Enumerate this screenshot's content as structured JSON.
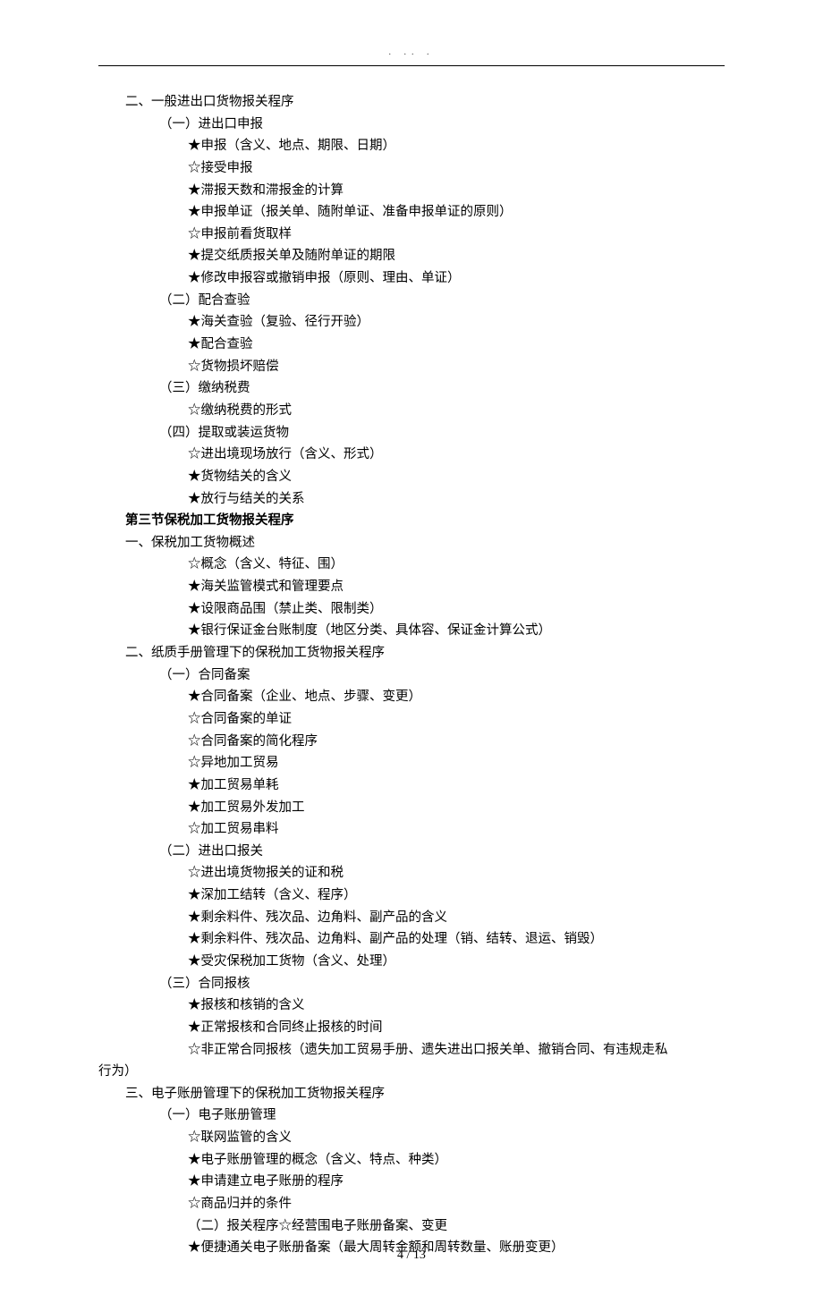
{
  "header_marks": ". .. .",
  "footer": "4 / 13",
  "lines": [
    {
      "cls": "l0",
      "text": "二、一般进出口货物报关程序"
    },
    {
      "cls": "l1",
      "text": "（一）进出口申报"
    },
    {
      "cls": "l2",
      "text": "★申报（含义、地点、期限、日期）"
    },
    {
      "cls": "l2",
      "text": "☆接受申报"
    },
    {
      "cls": "l2",
      "text": "★滞报天数和滞报金的计算"
    },
    {
      "cls": "l2",
      "text": "★申报单证（报关单、随附单证、准备申报单证的原则）"
    },
    {
      "cls": "l2",
      "text": "☆申报前看货取样"
    },
    {
      "cls": "l2",
      "text": "★提交纸质报关单及随附单证的期限"
    },
    {
      "cls": "l2",
      "text": "★修改申报容或撤销申报（原则、理由、单证）"
    },
    {
      "cls": "l1",
      "text": "（二）配合查验"
    },
    {
      "cls": "l2",
      "text": "★海关查验（复验、径行开验）"
    },
    {
      "cls": "l2",
      "text": "★配合查验"
    },
    {
      "cls": "l2",
      "text": "☆货物损坏赔偿"
    },
    {
      "cls": "l1",
      "text": "（三）缴纳税费"
    },
    {
      "cls": "l2",
      "text": "☆缴纳税费的形式"
    },
    {
      "cls": "l1",
      "text": "（四）提取或装运货物"
    },
    {
      "cls": "l2",
      "text": "☆进出境现场放行（含义、形式）"
    },
    {
      "cls": "l2",
      "text": "★货物结关的含义"
    },
    {
      "cls": "l2",
      "text": "★放行与结关的关系"
    },
    {
      "cls": "l0 bold",
      "text": "第三节保税加工货物报关程序"
    },
    {
      "cls": "l0",
      "text": "一、保税加工货物概述"
    },
    {
      "cls": "l2",
      "text": "☆概念（含义、特征、围）"
    },
    {
      "cls": "l2",
      "text": "★海关监管模式和管理要点"
    },
    {
      "cls": "l2",
      "text": "★设限商品围（禁止类、限制类）"
    },
    {
      "cls": "l2",
      "text": "★银行保证金台账制度（地区分类、具体容、保证金计算公式）"
    },
    {
      "cls": "l0",
      "text": "二、纸质手册管理下的保税加工货物报关程序"
    },
    {
      "cls": "l1",
      "text": "（一）合同备案"
    },
    {
      "cls": "l2",
      "text": "★合同备案（企业、地点、步骤、变更）"
    },
    {
      "cls": "l2",
      "text": "☆合同备案的单证"
    },
    {
      "cls": "l2",
      "text": "☆合同备案的简化程序"
    },
    {
      "cls": "l2",
      "text": "☆异地加工贸易"
    },
    {
      "cls": "l2",
      "text": "★加工贸易单耗"
    },
    {
      "cls": "l2",
      "text": "★加工贸易外发加工"
    },
    {
      "cls": "l2",
      "text": "☆加工贸易串料"
    },
    {
      "cls": "l1",
      "text": "（二）进出口报关"
    },
    {
      "cls": "l2",
      "text": "☆进出境货物报关的证和税"
    },
    {
      "cls": "l2",
      "text": "★深加工结转（含义、程序）"
    },
    {
      "cls": "l2",
      "text": "★剩余料件、残次品、边角料、副产品的含义"
    },
    {
      "cls": "l2",
      "text": "★剩余料件、残次品、边角料、副产品的处理（销、结转、退运、销毁）"
    },
    {
      "cls": "l2",
      "text": "★受灾保税加工货物（含义、处理）"
    },
    {
      "cls": "l1",
      "text": "（三）合同报核"
    },
    {
      "cls": "l2",
      "text": "★报核和核销的含义"
    },
    {
      "cls": "l2",
      "text": "★正常报核和合同终止报核的时间"
    },
    {
      "cls": "l2",
      "text": "☆非正常合同报核（遗失加工贸易手册、遗失进出口报关单、撤销合同、有违规走私"
    },
    {
      "cls": "hang",
      "text": "行为）"
    },
    {
      "cls": "l0",
      "text": "三、电子账册管理下的保税加工货物报关程序"
    },
    {
      "cls": "l1",
      "text": "（一）电子账册管理"
    },
    {
      "cls": "l2",
      "text": "☆联网监管的含义"
    },
    {
      "cls": "l2",
      "text": "★电子账册管理的概念（含义、特点、种类）"
    },
    {
      "cls": "l2",
      "text": "★申请建立电子账册的程序"
    },
    {
      "cls": "l2",
      "text": "☆商品归并的条件"
    },
    {
      "cls": "l2",
      "text": "（二）报关程序☆经营围电子账册备案、变更"
    },
    {
      "cls": "l2",
      "text": "★便捷通关电子账册备案（最大周转金额和周转数量、账册变更）"
    }
  ]
}
